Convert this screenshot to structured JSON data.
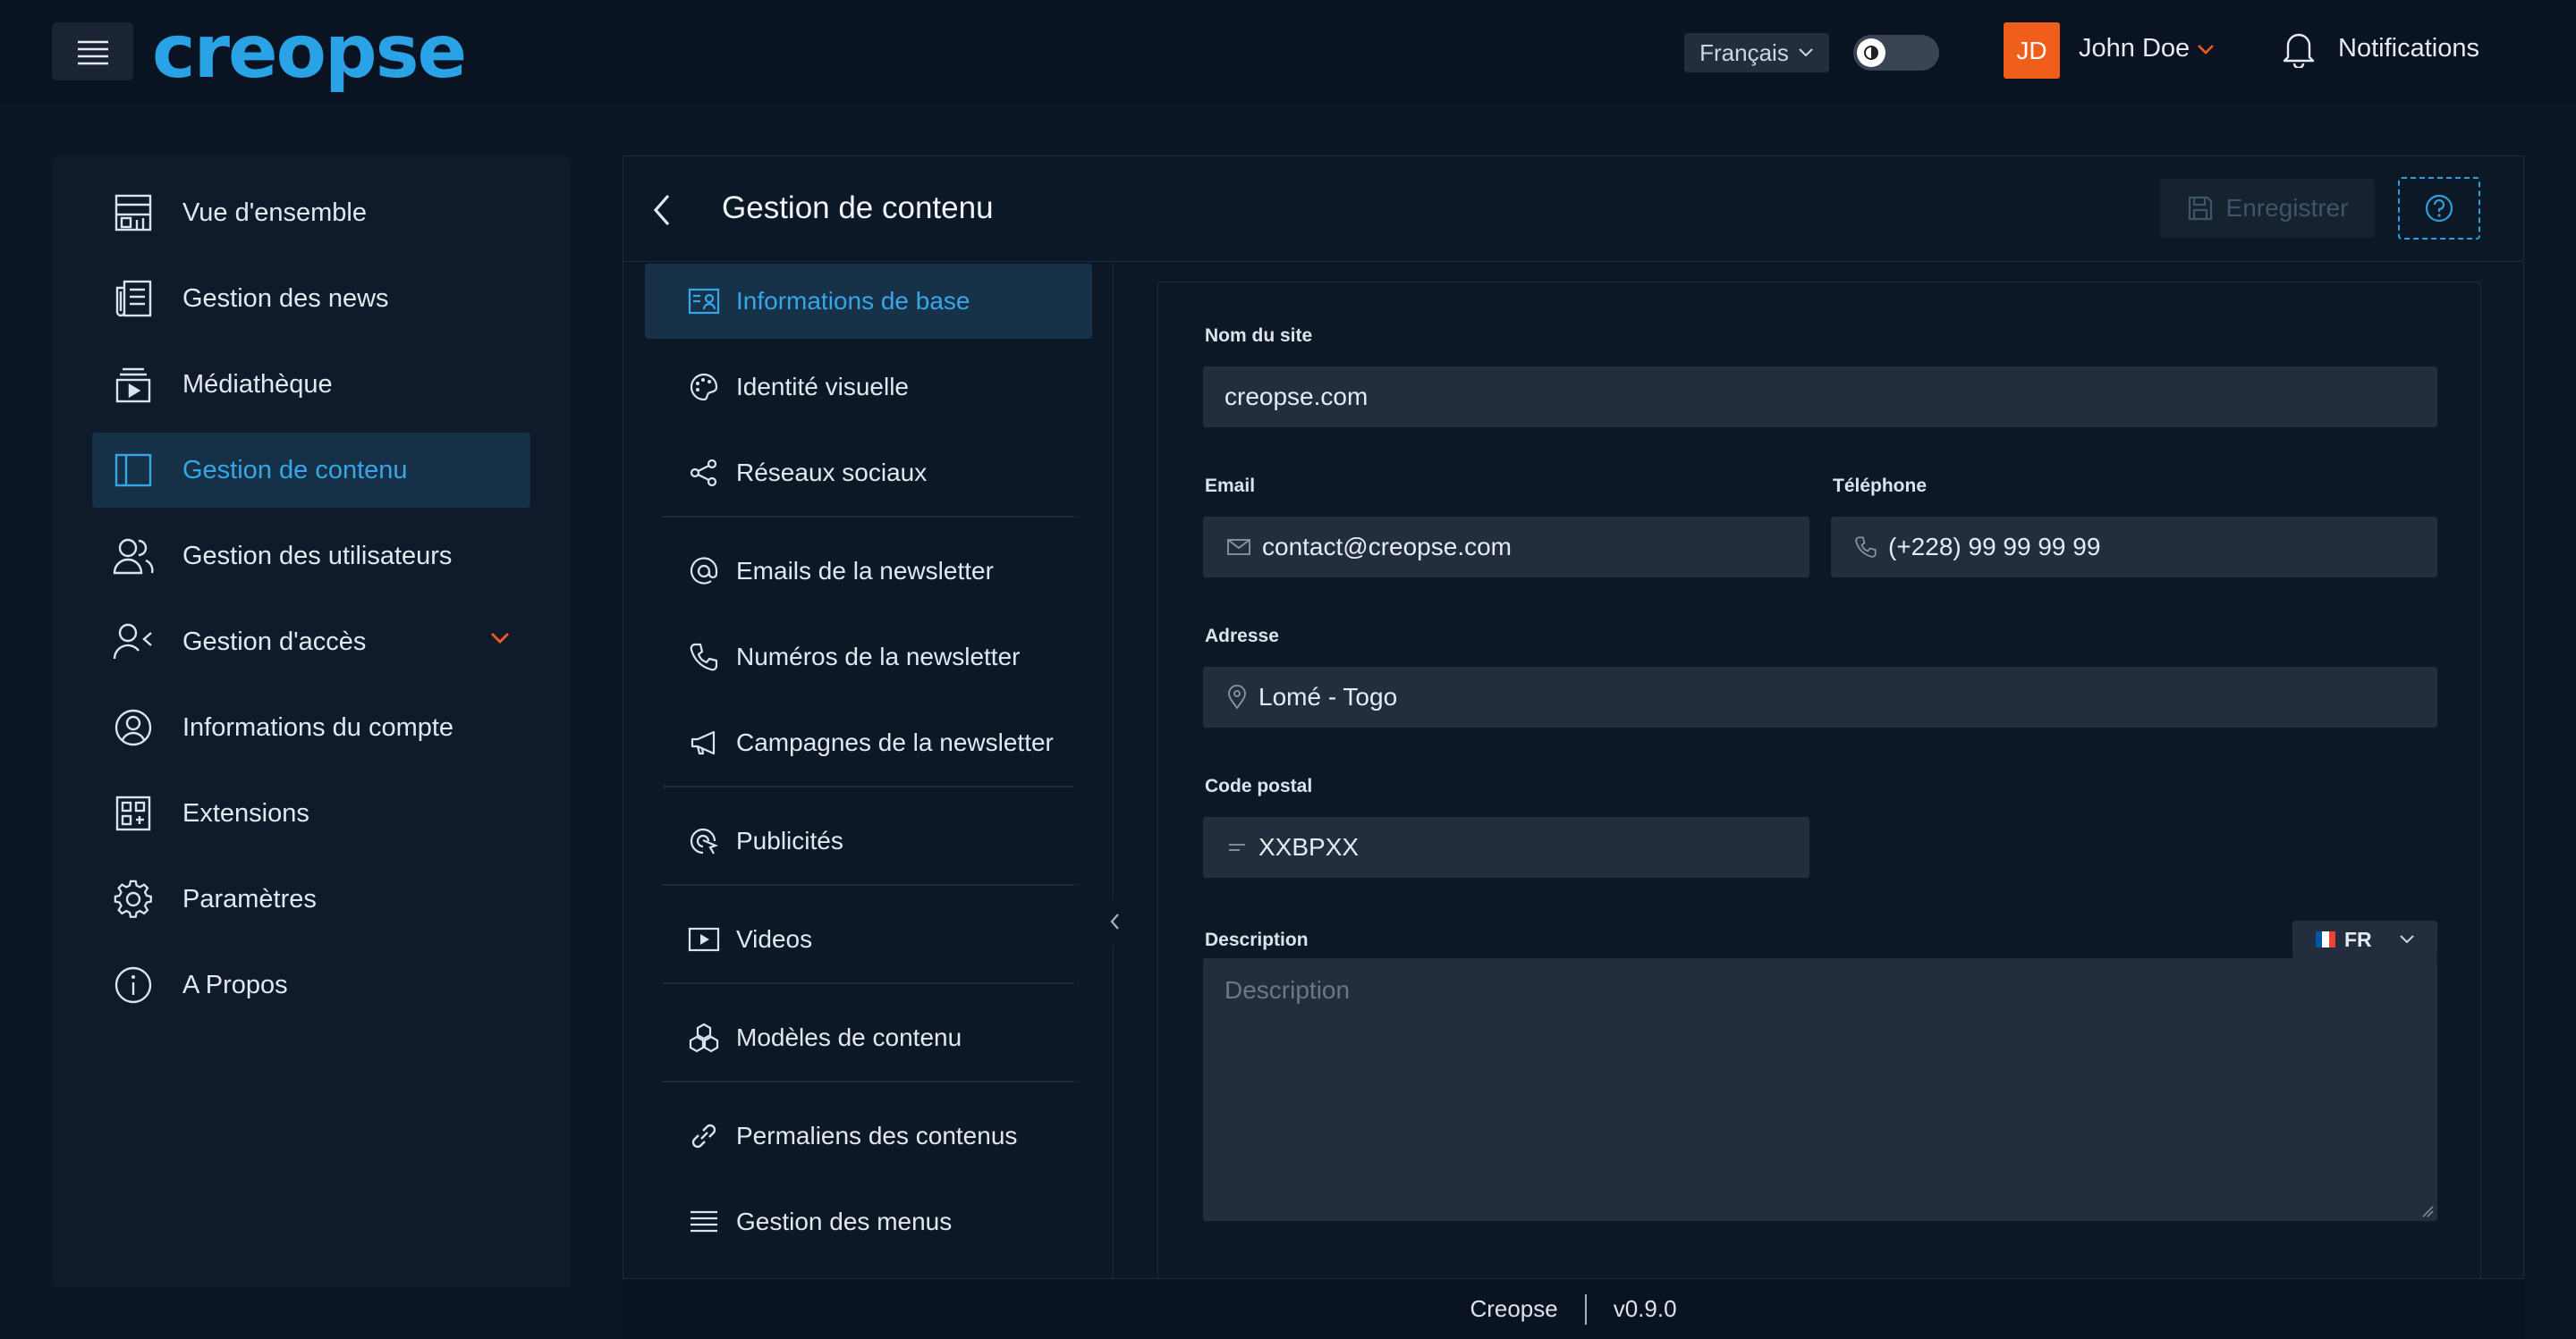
{
  "app": {
    "logo_text": "creopse",
    "brand_color": "#29a3e6",
    "accent_color": "#f05e1c"
  },
  "header": {
    "language": "Français",
    "user_initials": "JD",
    "user_name": "John Doe",
    "notifications_label": "Notifications"
  },
  "sidebar": {
    "items": [
      {
        "label": "Vue d'ensemble",
        "icon": "dashboard-icon"
      },
      {
        "label": "Gestion des news",
        "icon": "newspaper-icon"
      },
      {
        "label": "Médiathèque",
        "icon": "media-library-icon"
      },
      {
        "label": "Gestion de contenu",
        "icon": "layout-icon",
        "active": true
      },
      {
        "label": "Gestion des utilisateurs",
        "icon": "users-icon"
      },
      {
        "label": "Gestion d'accès",
        "icon": "user-access-icon",
        "expandable": true
      },
      {
        "label": "Informations du compte",
        "icon": "user-circle-icon"
      },
      {
        "label": "Extensions",
        "icon": "extensions-icon"
      },
      {
        "label": "Paramètres",
        "icon": "gear-icon"
      },
      {
        "label": "A Propos",
        "icon": "info-icon"
      }
    ]
  },
  "panel": {
    "title": "Gestion de contenu",
    "save_label": "Enregistrer"
  },
  "subnav": {
    "items": [
      {
        "label": "Informations de base",
        "icon": "id-card-icon",
        "active": true
      },
      {
        "label": "Identité visuelle",
        "icon": "palette-icon"
      },
      {
        "label": "Réseaux sociaux",
        "icon": "share-icon"
      },
      {
        "label": "Emails de la newsletter",
        "icon": "at-icon"
      },
      {
        "label": "Numéros de la newsletter",
        "icon": "phone-icon"
      },
      {
        "label": "Campagnes de la newsletter",
        "icon": "megaphone-icon"
      },
      {
        "label": "Publicités",
        "icon": "ads-icon"
      },
      {
        "label": "Videos",
        "icon": "video-icon"
      },
      {
        "label": "Modèles de contenu",
        "icon": "cubes-icon"
      },
      {
        "label": "Permaliens des contenus",
        "icon": "link-icon"
      },
      {
        "label": "Gestion des menus",
        "icon": "menu-lines-icon"
      }
    ]
  },
  "form": {
    "site_name_label": "Nom du site",
    "site_name_value": "creopse.com",
    "email_label": "Email",
    "email_value": "contact@creopse.com",
    "phone_label": "Téléphone",
    "phone_value": "(+228) 99 99 99 99",
    "address_label": "Adresse",
    "address_value": "Lomé - Togo",
    "postal_label": "Code postal",
    "postal_value": "XXBPXX",
    "description_label": "Description",
    "description_placeholder": "Description",
    "locale_label": "FR"
  },
  "footer": {
    "app_name": "Creopse",
    "version": "v0.9.0"
  }
}
